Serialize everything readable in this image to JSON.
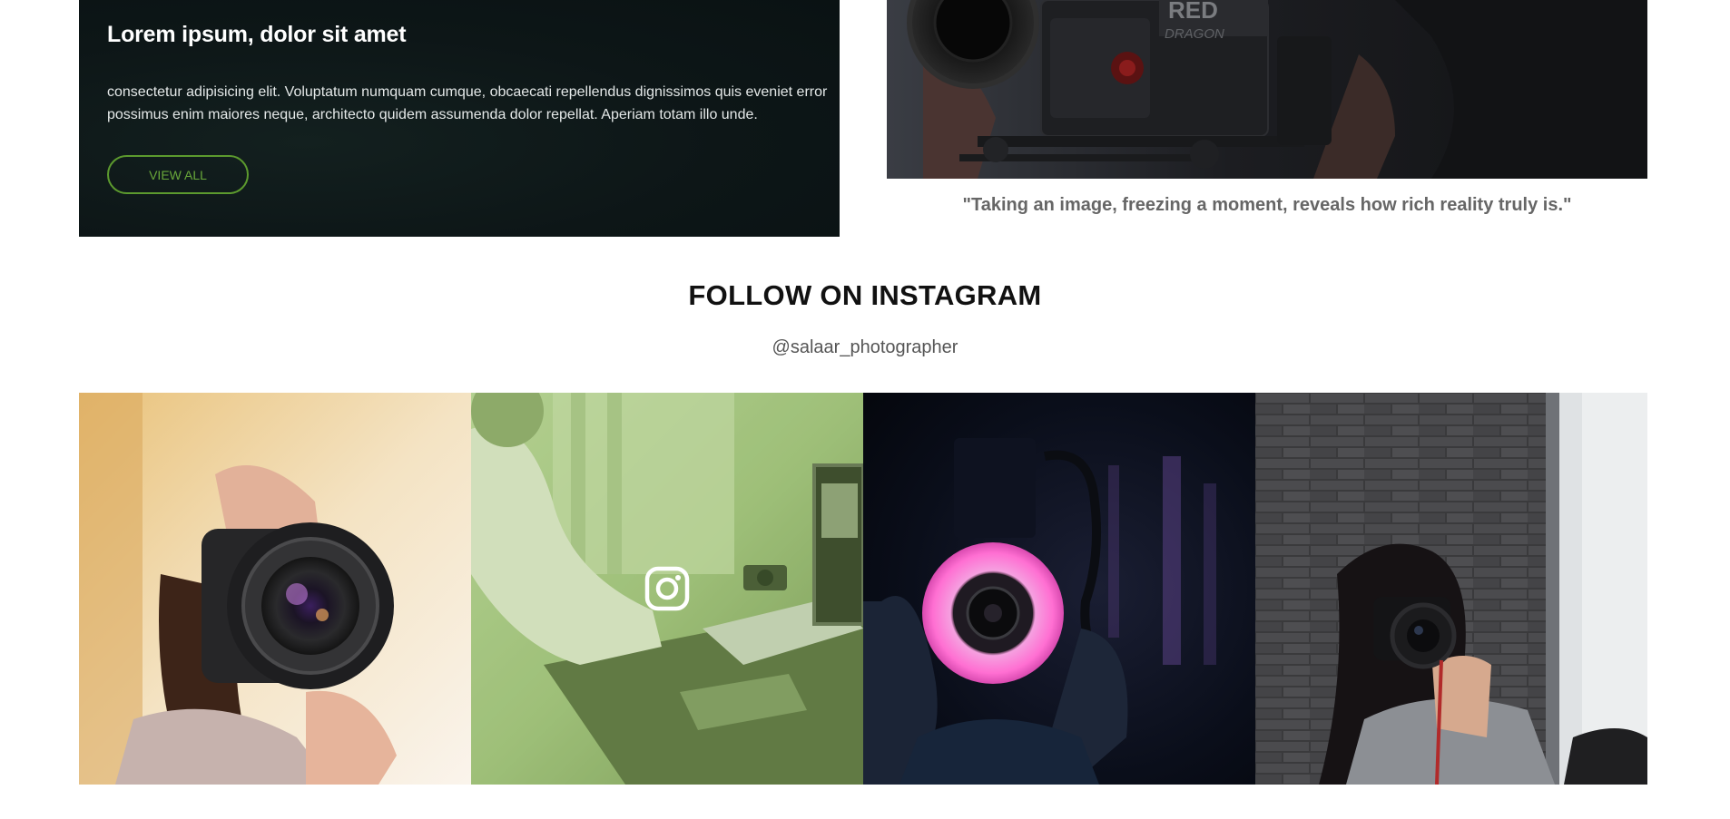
{
  "promo": {
    "title": "Lorem ipsum, dolor sit amet",
    "body": "consectetur adipisicing elit. Voluptatum numquam cumque, obcaecati repellendus dignissimos quis eveniet error possimus enim maiores neque, architecto quidem assumenda dolor repellat. Aperiam totam illo unde.",
    "button_label": "VIEW ALL"
  },
  "hero": {
    "camera_brand_text": "RED",
    "camera_model_text": "DRAGON",
    "quote": "\"Taking an image, freezing a moment, reveals how rich reality truly is.\""
  },
  "instagram": {
    "heading": "FOLLOW ON INSTAGRAM",
    "handle": "@salaar_photographer",
    "posts": [
      {
        "subject": "woman-with-dslr-camera"
      },
      {
        "subject": "person-at-laptop-desk",
        "hover_icon": "instagram-icon"
      },
      {
        "subject": "ring-light-camera"
      },
      {
        "subject": "girl-with-camera-brick-wall"
      }
    ]
  },
  "colors": {
    "accent": "#5c9a2e",
    "dark_card_bg": "#0d1617",
    "quote_text": "#666666"
  }
}
